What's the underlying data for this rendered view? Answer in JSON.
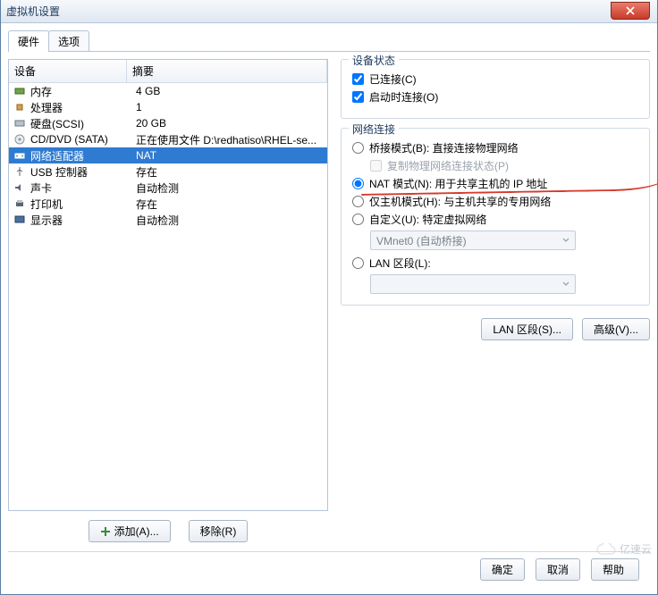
{
  "window": {
    "title": "虚拟机设置"
  },
  "tabs": {
    "hardware": "硬件",
    "options": "选项"
  },
  "device_list": {
    "header_device": "设备",
    "header_summary": "摘要",
    "rows": [
      {
        "icon": "memory-icon",
        "name": "内存",
        "summary": "4 GB"
      },
      {
        "icon": "cpu-icon",
        "name": "处理器",
        "summary": "1"
      },
      {
        "icon": "disk-icon",
        "name": "硬盘(SCSI)",
        "summary": "20 GB"
      },
      {
        "icon": "cd-icon",
        "name": "CD/DVD (SATA)",
        "summary": "正在使用文件 D:\\redhatiso\\RHEL-se..."
      },
      {
        "icon": "network-icon",
        "name": "网络适配器",
        "summary": "NAT",
        "selected": true
      },
      {
        "icon": "usb-icon",
        "name": "USB 控制器",
        "summary": "存在"
      },
      {
        "icon": "sound-icon",
        "name": "声卡",
        "summary": "自动检测"
      },
      {
        "icon": "printer-icon",
        "name": "打印机",
        "summary": "存在"
      },
      {
        "icon": "display-icon",
        "name": "显示器",
        "summary": "自动检测"
      }
    ]
  },
  "left_buttons": {
    "add": "添加(A)...",
    "remove": "移除(R)"
  },
  "status_group": {
    "legend": "设备状态",
    "connected": "已连接(C)",
    "connect_at_poweron": "启动时连接(O)"
  },
  "network_group": {
    "legend": "网络连接",
    "bridged": "桥接模式(B): 直接连接物理网络",
    "replicate": "复制物理网络连接状态(P)",
    "nat": "NAT 模式(N): 用于共享主机的 IP 地址",
    "hostonly": "仅主机模式(H): 与主机共享的专用网络",
    "custom": "自定义(U): 特定虚拟网络",
    "custom_select": "VMnet0 (自动桥接)",
    "lan_segment": "LAN 区段(L):",
    "lan_select": ""
  },
  "right_buttons": {
    "lan_segments": "LAN 区段(S)...",
    "advanced": "高级(V)..."
  },
  "footer": {
    "ok": "确定",
    "cancel": "取消",
    "help": "帮助"
  },
  "watermark": "亿速云"
}
